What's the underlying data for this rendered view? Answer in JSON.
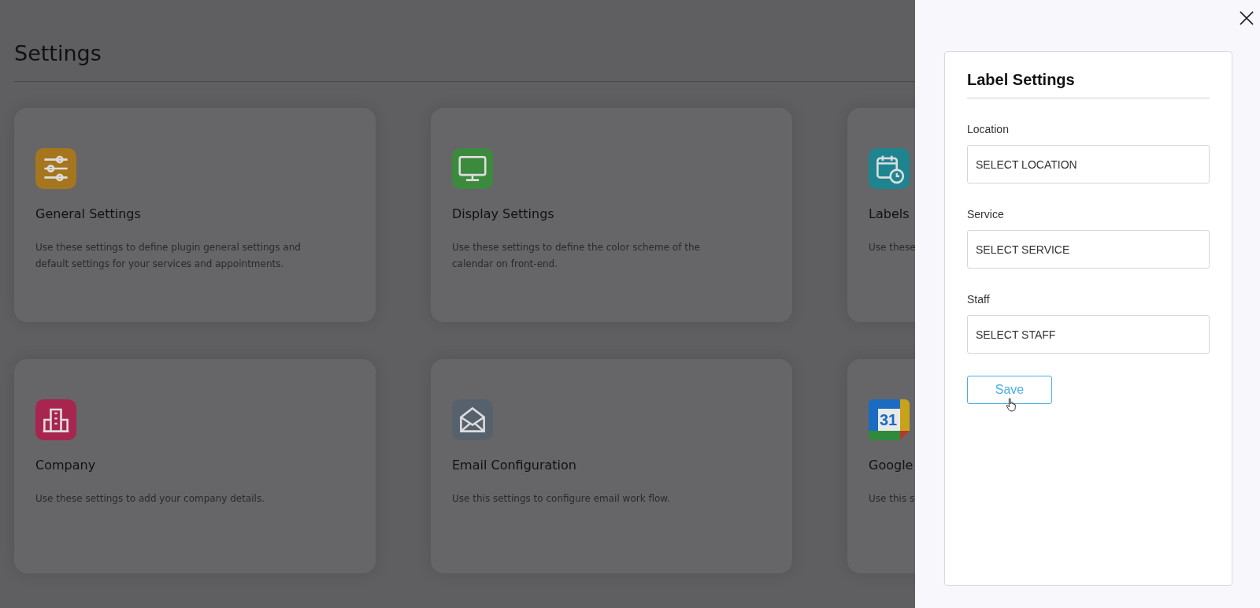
{
  "page": {
    "title": "Settings"
  },
  "cards": [
    {
      "kind": "sliders",
      "color": "#a5761d",
      "title": "General Settings",
      "description": "Use these settings to define plugin general settings and default settings for your services and appointments."
    },
    {
      "kind": "monitor",
      "color": "#3b8a3e",
      "title": "Display Settings",
      "description": "Use these settings to define the color scheme of the calendar on front-end."
    },
    {
      "kind": "calendar-clock",
      "color": "#1e8590",
      "title": "Labels",
      "description": "Use these"
    },
    {
      "kind": "building",
      "color": "#a82550",
      "title": "Company",
      "description": "Use these settings to add your company details."
    },
    {
      "kind": "envelope",
      "color": "#56616d",
      "title": "Email Configuration",
      "description": "Use this settings to configure email work flow."
    },
    {
      "kind": "date-tile",
      "color": "#1a6bc2",
      "title": "Google",
      "description": "Use this s",
      "date": "31"
    }
  ],
  "panel": {
    "title": "Label Settings",
    "fields": [
      {
        "label": "Location",
        "value": "SELECT LOCATION"
      },
      {
        "label": "Service",
        "value": "SELECT SERVICE"
      },
      {
        "label": "Staff",
        "value": "SELECT STAFF"
      }
    ],
    "save_button": "Save"
  }
}
